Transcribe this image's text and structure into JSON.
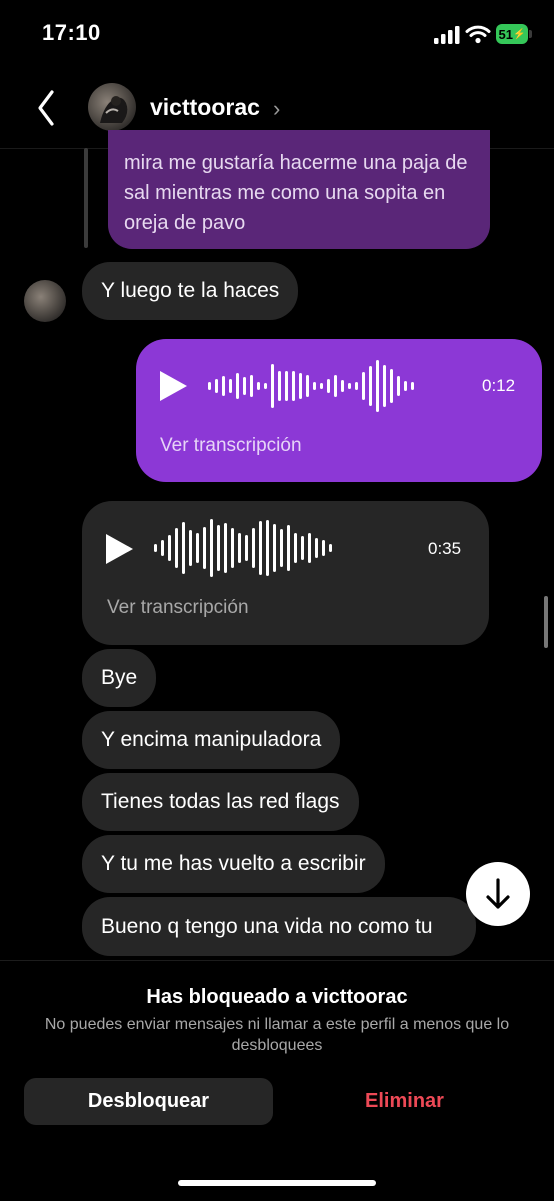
{
  "status_bar": {
    "time": "17:10",
    "battery": "51"
  },
  "header": {
    "username": "victtoorac"
  },
  "messages": {
    "quoted_text": "mira me gustaría hacerme una paja de sal mientras me como una sopita en oreja de pavo",
    "reply": "Y luego te la haces",
    "voice_sent": {
      "duration": "0:12",
      "transcript_label": "Ver transcripción"
    },
    "voice_received": {
      "duration": "0:35",
      "transcript_label": "Ver transcripción"
    },
    "bye": "Bye",
    "manipuladora": "Y encima manipuladora",
    "red_flags": "Tienes todas las red flags",
    "vuelto": "Y tu me has vuelto a escribir",
    "bueno": "Bueno q tengo una vida no como tu"
  },
  "blocked_panel": {
    "title": "Has bloqueado a victtoorac",
    "description": "No puedes enviar mensajes ni llamar a este perfil a menos que lo desbloquees",
    "unblock_label": "Desbloquear",
    "delete_label": "Eliminar"
  },
  "colors": {
    "sent_bubble": "#8c38d6",
    "quoted_bubble": "#5a2678",
    "received_bubble": "#262626",
    "danger": "#ed4956",
    "battery": "#35c759"
  },
  "icons": [
    "back-chevron-icon",
    "chevron-right-icon",
    "play-icon",
    "waveform-icon",
    "arrow-down-icon",
    "signal-icon",
    "wifi-icon",
    "battery-icon"
  ]
}
